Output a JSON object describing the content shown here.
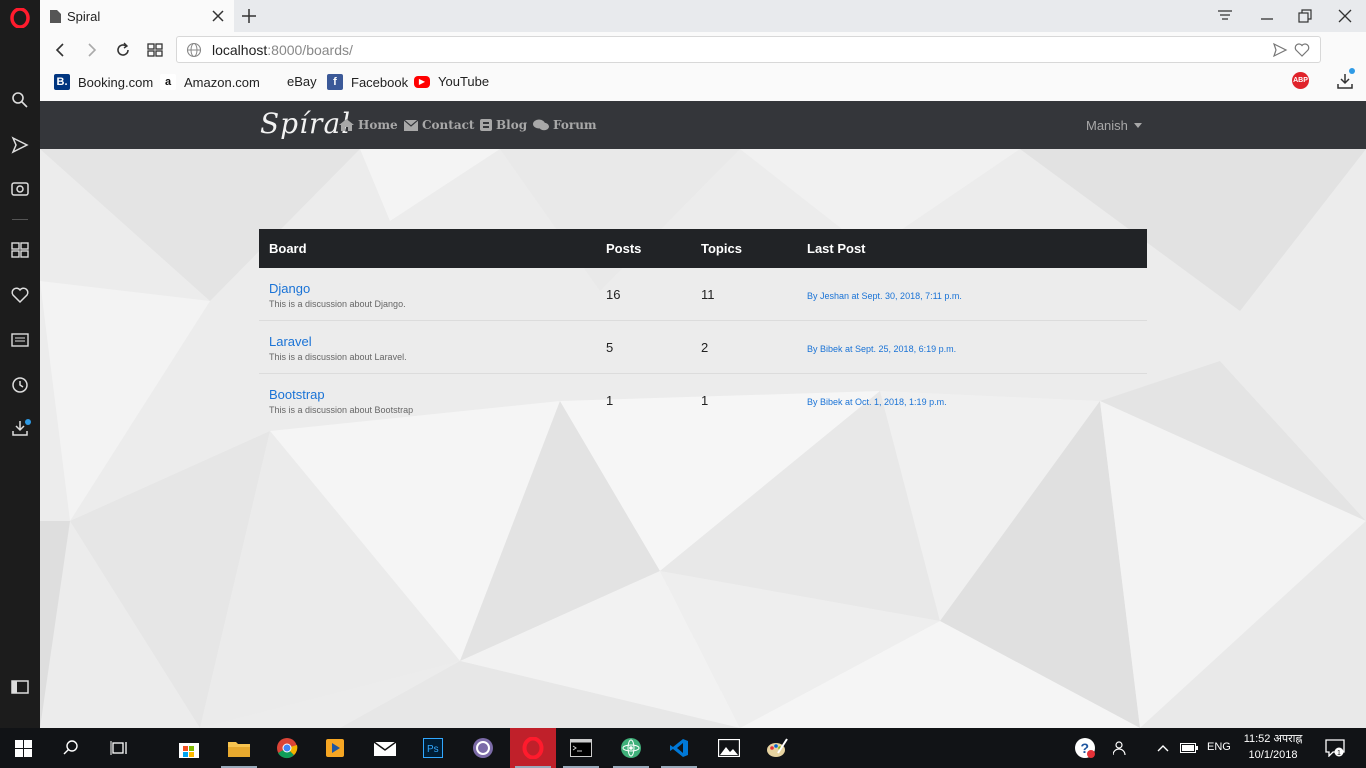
{
  "browser": {
    "tab_title": "Spiral",
    "url_host": "localhost",
    "url_rest": ":8000/boards/",
    "abp_label": "ABP"
  },
  "bookmarks": [
    {
      "label": "Booking.com",
      "icon": "booking-icon",
      "glyph": "B.",
      "color": "#003580"
    },
    {
      "label": "Amazon.com",
      "icon": "amazon-icon",
      "glyph": "a",
      "color": "#ffffff"
    },
    {
      "label": "eBay",
      "icon": "ebay-icon",
      "glyph": "",
      "color": "#ffffff"
    },
    {
      "label": "Facebook",
      "icon": "facebook-icon",
      "glyph": "f",
      "color": "#3b5998"
    },
    {
      "label": "YouTube",
      "icon": "youtube-icon",
      "glyph": "▶",
      "color": "#ff0000"
    }
  ],
  "site": {
    "brand": "Spíral",
    "nav": [
      {
        "label": "Home",
        "icon": "home-icon"
      },
      {
        "label": "Contact",
        "icon": "envelope-icon"
      },
      {
        "label": "Blog",
        "icon": "blog-icon"
      },
      {
        "label": "Forum",
        "icon": "comments-icon"
      }
    ],
    "user": "Manish"
  },
  "table": {
    "headers": [
      "Board",
      "Posts",
      "Topics",
      "Last Post"
    ],
    "rows": [
      {
        "name": "Django",
        "description": "This is a discussion about Django.",
        "posts": "16",
        "topics": "11",
        "last_post": "By Jeshan at Sept. 30, 2018, 7:11 p.m."
      },
      {
        "name": "Laravel",
        "description": "This is a discussion about Laravel.",
        "posts": "5",
        "topics": "2",
        "last_post": "By Bibek at Sept. 25, 2018, 6:19 p.m."
      },
      {
        "name": "Bootstrap",
        "description": "This is a discussion about Bootstrap",
        "posts": "1",
        "topics": "1",
        "last_post": "By Bibek at Oct. 1, 2018, 1:19 p.m."
      }
    ]
  },
  "taskbar": {
    "time": "11:52 अपराह्न",
    "date": "10/1/2018",
    "language": "ENG"
  },
  "colors": {
    "link": "#1a73d6",
    "navbar": "#34363a",
    "table_header": "#212326",
    "opera_red": "#e0232b"
  }
}
